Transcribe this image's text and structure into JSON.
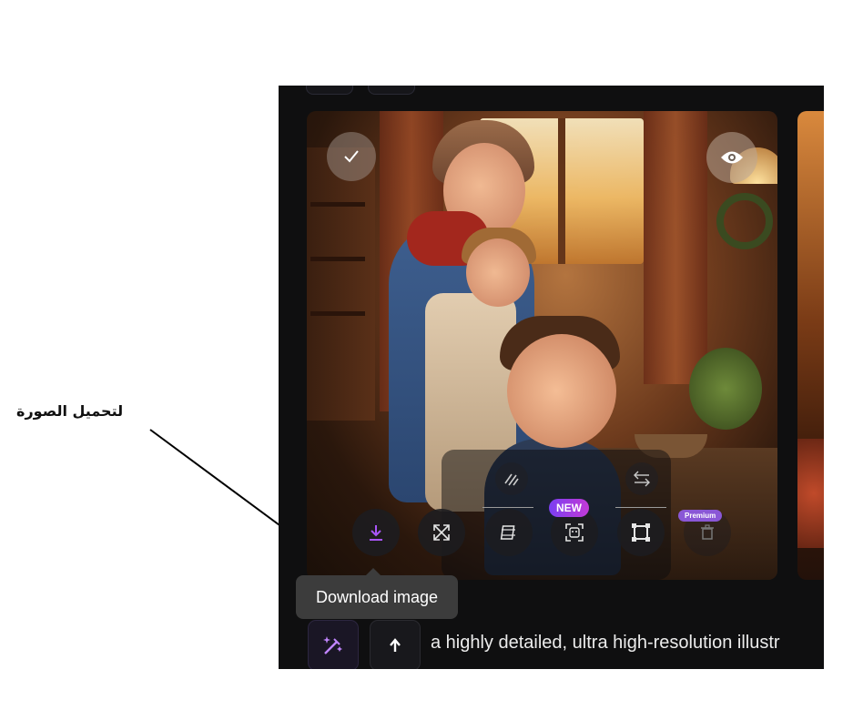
{
  "annotation": {
    "label": "لتحميل الصورة"
  },
  "image_card": {
    "select_icon": "check-icon",
    "preview_icon": "eye-icon"
  },
  "toolbar": {
    "tools": [
      {
        "name": "download-image",
        "icon": "download-icon",
        "accent": "#a855f7"
      },
      {
        "name": "upscale",
        "icon": "expand-icon"
      },
      {
        "name": "animate",
        "icon": "film-icon"
      },
      {
        "name": "remove-background",
        "icon": "face-scan-icon"
      },
      {
        "name": "resize",
        "icon": "crop-frame-icon"
      },
      {
        "name": "delete",
        "icon": "trash-icon"
      }
    ],
    "upper_tools": [
      {
        "name": "variations",
        "icon": "slash-lines-icon"
      },
      {
        "name": "swap",
        "icon": "swap-arrows-icon"
      }
    ],
    "badges": {
      "new": "NEW",
      "premium": "Premium"
    }
  },
  "tooltip": {
    "text": "Download image"
  },
  "prompt_bar": {
    "magic_icon": "magic-wand-icon",
    "upload_icon": "arrow-up-icon",
    "text": "a highly detailed, ultra high-resolution illustr"
  },
  "colors": {
    "panel_bg": "#0f0f10",
    "accent_purple": "#a855f7",
    "tooltip_bg": "#3c3c3c"
  }
}
